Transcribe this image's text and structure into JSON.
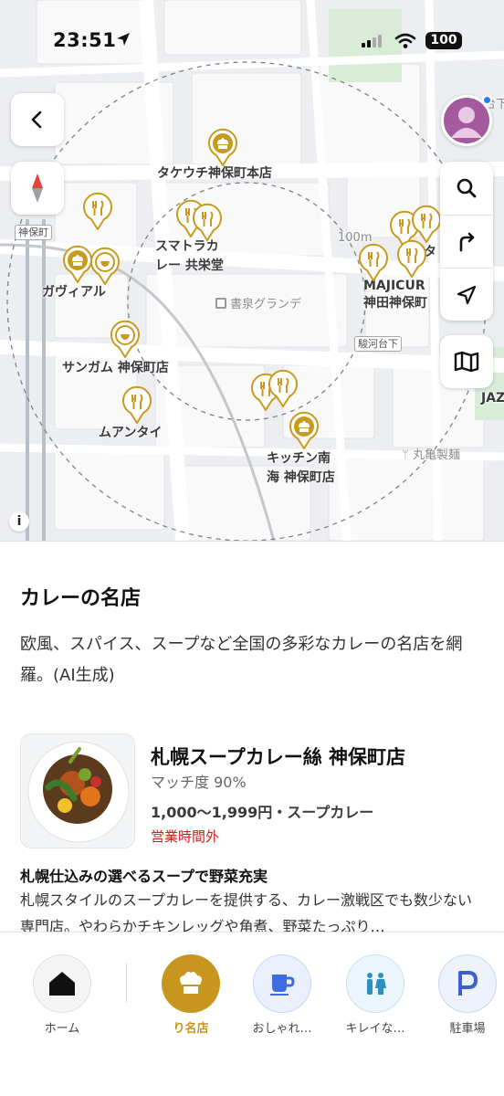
{
  "status": {
    "time": "23:51",
    "battery": "100"
  },
  "map": {
    "scale_label": "100m",
    "place_labels": {
      "takeuchi": "タケウチ神保町本店",
      "sumatora": "スマトラカ\nレー 共栄堂",
      "gavial": "ガヴィアル",
      "sangam": "サンガム 神保町店",
      "moantai": "ムアンタイ",
      "kitchen": "キッチン南\n海 神保町店",
      "majicurry": "MAJICUR\n神田神保町",
      "hinata": "ヒナタ",
      "shosen": "書泉グランデ",
      "marukame": "丸亀製麺",
      "jaz": "JAZ"
    },
    "station_signs": {
      "jimbocho": "神保町",
      "surugadai": "駿河台下",
      "top_right": "台下"
    },
    "info_label": "i"
  },
  "sheet": {
    "title": "カレーの名店",
    "description": "欧風、スパイス、スープなど全国の多彩なカレーの名店を網羅。(AI生成)",
    "shop": {
      "name": "札幌スープカレー絲 神保町店",
      "match": "マッチ度 90%",
      "price_genre": "1,000〜1,999円・スープカレー",
      "hours_status": "営業時間外",
      "headline": "札幌仕込みの選べるスープで野菜充実",
      "body": "札幌スタイルのスープカレーを提供する、カレー激戦区でも数少ない専門店。やわらかチキンレッグや角煮、野菜たっぷり…"
    }
  },
  "tabs": {
    "home": "ホーム",
    "meiten": "り名店",
    "oshare": "おしゃれ…",
    "kirei": "キレイな…",
    "parking": "駐車場"
  },
  "colors": {
    "pin_gold": "#c89a1f",
    "active_tab": "#c8961f",
    "closed_red": "#d01c1c",
    "avatar": "#a45a9d"
  },
  "icons": [
    "location-arrow-icon",
    "back-chevron-icon",
    "compass-icon",
    "search-icon",
    "directions-icon",
    "navigate-icon",
    "map-icon",
    "avatar-icon",
    "chef-hat-icon",
    "fork-knife-icon",
    "home-icon",
    "coffee-icon",
    "restroom-icon",
    "parking-icon"
  ]
}
